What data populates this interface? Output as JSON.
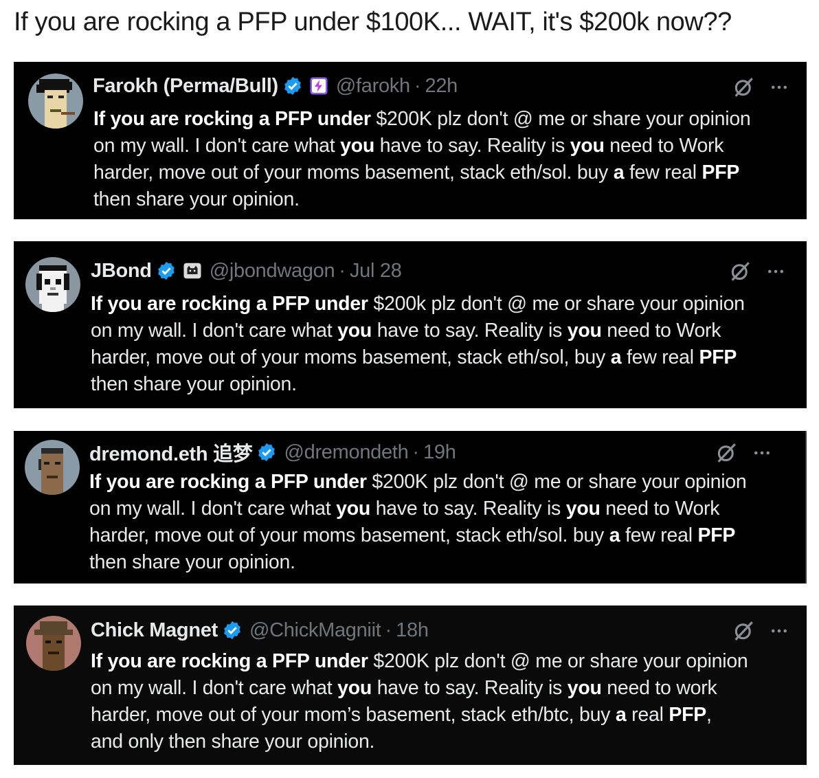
{
  "page_title": "If you are rocking a PFP under $100K... WAIT, it's $200k now??",
  "colors": {
    "tweet_bg": "#000000",
    "text": "#e7e9ea",
    "muted": "#71767b",
    "verified": "#1d9bf0"
  },
  "tweets": [
    {
      "name": "Farokh (Perma/Bull)",
      "handle": "@farokh",
      "dot": "·",
      "time": "22h",
      "affiliate_icon": "lightning-badge-icon",
      "avatar_icon": "pixel-punk-avatar",
      "lines": [
        [
          {
            "b": "If you are rocking a PFP under"
          },
          {
            "t": " $200K plz don't @ me or share your opinion"
          }
        ],
        [
          {
            "t": "on my wall. I don't care what "
          },
          {
            "b": "you"
          },
          {
            "t": " have to say. Reality is "
          },
          {
            "b": "you"
          },
          {
            "t": " need to Work"
          }
        ],
        [
          {
            "t": "harder, move out of your moms basement, stack eth/sol. buy "
          },
          {
            "b": "a"
          },
          {
            "t": " few real "
          },
          {
            "b": "PFP"
          }
        ],
        [
          {
            "t": "then share your opinion."
          }
        ]
      ]
    },
    {
      "name": "JBond",
      "handle": "@jbondwagon",
      "dot": "·",
      "time": "Jul 28",
      "affiliate_icon": "cat-badge-icon",
      "avatar_icon": "pixel-ape-avatar",
      "lines": [
        [
          {
            "b": "If you are rocking a PFP under"
          },
          {
            "t": " $200k plz don't @ me or share your opinion"
          }
        ],
        [
          {
            "t": "on my wall. I don't care what "
          },
          {
            "b": "you"
          },
          {
            "t": " have to say. Reality is "
          },
          {
            "b": "you"
          },
          {
            "t": " need to Work"
          }
        ],
        [
          {
            "t": "harder, move out of your moms basement, stack eth/sol, buy "
          },
          {
            "b": "a"
          },
          {
            "t": " few real "
          },
          {
            "b": "PFP"
          }
        ],
        [
          {
            "t": "then share your opinion."
          }
        ]
      ]
    },
    {
      "name": "dremond.eth 追梦",
      "handle": "@dremondeth",
      "dot": "·",
      "time": "19h",
      "affiliate_icon": "",
      "avatar_icon": "pixel-punk-avatar",
      "lines": [
        [
          {
            "b": "If you are rocking a PFP under"
          },
          {
            "t": " $200K plz don't @ me or share your opinion"
          }
        ],
        [
          {
            "t": "on my wall. I don't care what "
          },
          {
            "b": "you"
          },
          {
            "t": " have to say. Reality is "
          },
          {
            "b": "you"
          },
          {
            "t": " need to Work"
          }
        ],
        [
          {
            "t": "harder, move out of your moms basement, stack eth/sol. buy "
          },
          {
            "b": "a"
          },
          {
            "t": " few real "
          },
          {
            "b": "PFP"
          }
        ],
        [
          {
            "t": "then share your opinion."
          }
        ]
      ]
    },
    {
      "name": "Chick Magnet",
      "handle": "@ChickMagniit",
      "dot": "·",
      "time": "18h",
      "affiliate_icon": "",
      "avatar_icon": "pixel-cowboy-avatar",
      "lines": [
        [
          {
            "b": "If you are rocking a PFP under"
          },
          {
            "t": " $200K plz don't @ me or share your opinion"
          }
        ],
        [
          {
            "t": "on my wall. I don't care what "
          },
          {
            "b": "you"
          },
          {
            "t": " have to say. Reality is "
          },
          {
            "b": "you"
          },
          {
            "t": " need to work"
          }
        ],
        [
          {
            "t": "harder, move out of your mom’s basement, stack eth/btc, buy "
          },
          {
            "b": "a"
          },
          {
            "t": " real "
          },
          {
            "b": "PFP"
          },
          {
            "t": ","
          }
        ],
        [
          {
            "t": "and only then share your opinion."
          }
        ]
      ]
    }
  ]
}
